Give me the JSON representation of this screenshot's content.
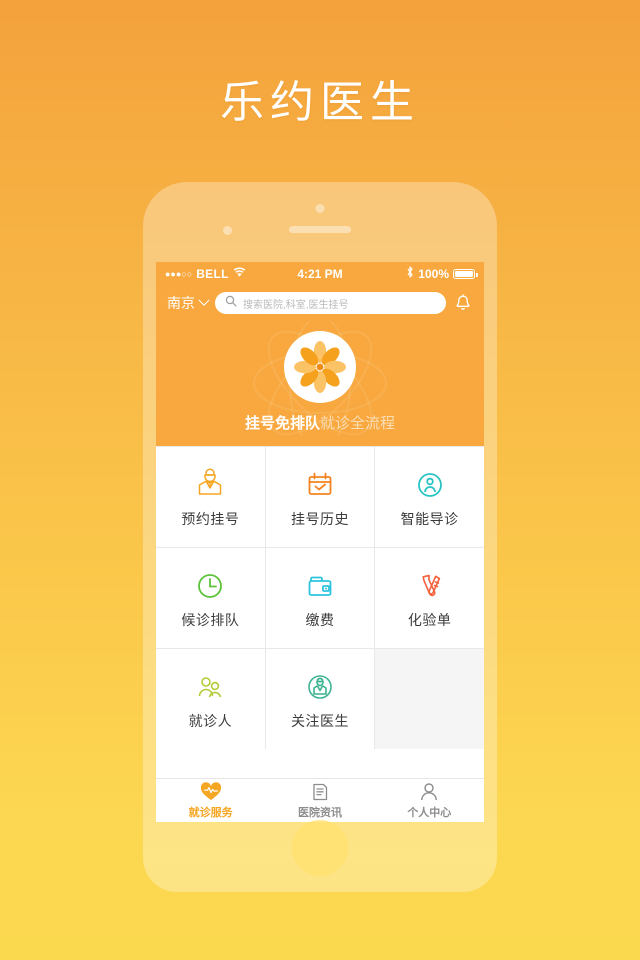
{
  "page": {
    "app_title": "乐约医生",
    "bg_gradient_start": "#f4a23c",
    "bg_gradient_end": "#fbd94f"
  },
  "statusbar": {
    "signal_dots": "●●●○○",
    "carrier": "BELL",
    "wifi_icon": "wifi-icon",
    "time": "4:21 PM",
    "bluetooth_icon": "bluetooth-icon",
    "battery_text": "100%",
    "battery_icon": "battery-full-icon"
  },
  "searchbar": {
    "city": "南京",
    "chevron_icon": "chevron-down-icon",
    "search_icon": "search-icon",
    "placeholder": "搜索医院,科室,医生挂号",
    "value": "",
    "bell_icon": "bell-icon"
  },
  "hero": {
    "logo_icon": "flower-logo-icon",
    "tagline_strong": "挂号免排队",
    "tagline_soft": "就诊全流程",
    "accent": "#f8a83e"
  },
  "grid": {
    "items": [
      {
        "label": "预约挂号",
        "icon": "doctor-icon",
        "color": "#f5a623"
      },
      {
        "label": "挂号历史",
        "icon": "calendar-check-icon",
        "color": "#f5821f"
      },
      {
        "label": "智能导诊",
        "icon": "guide-person-icon",
        "color": "#2bc4c4"
      },
      {
        "label": "候诊排队",
        "icon": "clock-icon",
        "color": "#5cc23a"
      },
      {
        "label": "缴费",
        "icon": "wallet-icon",
        "color": "#2ec4e0"
      },
      {
        "label": "化验单",
        "icon": "test-tube-icon",
        "color": "#f2603c"
      },
      {
        "label": "就诊人",
        "icon": "patients-icon",
        "color": "#b2cc36"
      },
      {
        "label": "关注医生",
        "icon": "doctor-circle-icon",
        "color": "#3cb391"
      },
      {
        "label": "",
        "icon": "",
        "color": ""
      }
    ]
  },
  "tabbar": {
    "tabs": [
      {
        "label": "就诊服务",
        "icon": "heart-pulse-icon",
        "active": true
      },
      {
        "label": "医院资讯",
        "icon": "document-icon",
        "active": false
      },
      {
        "label": "个人中心",
        "icon": "person-icon",
        "active": false
      }
    ],
    "active_color": "#f5a623",
    "inactive_color": "#8d8d8d"
  }
}
